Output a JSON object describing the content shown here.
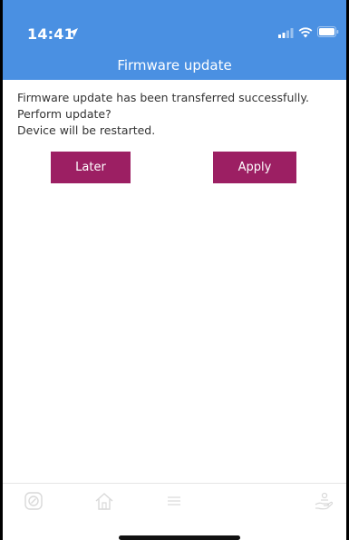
{
  "status_bar": {
    "time": "14:41",
    "icons": [
      "location-arrow-icon",
      "signal-icon",
      "wifi-icon",
      "battery-icon"
    ]
  },
  "header": {
    "title": "Firmware update"
  },
  "message": {
    "line1": "Firmware update has been transferred successfully. Perform update?",
    "line2": "Device will be restarted."
  },
  "buttons": {
    "later": "Later",
    "apply": "Apply"
  },
  "tab_bar": {
    "items": [
      "device-icon",
      "home-icon",
      "menu-icon",
      "hand-service-icon"
    ]
  },
  "colors": {
    "header": "#4a90e2",
    "button": "#9c1f63",
    "tab_icon": "#d9d9d9"
  }
}
